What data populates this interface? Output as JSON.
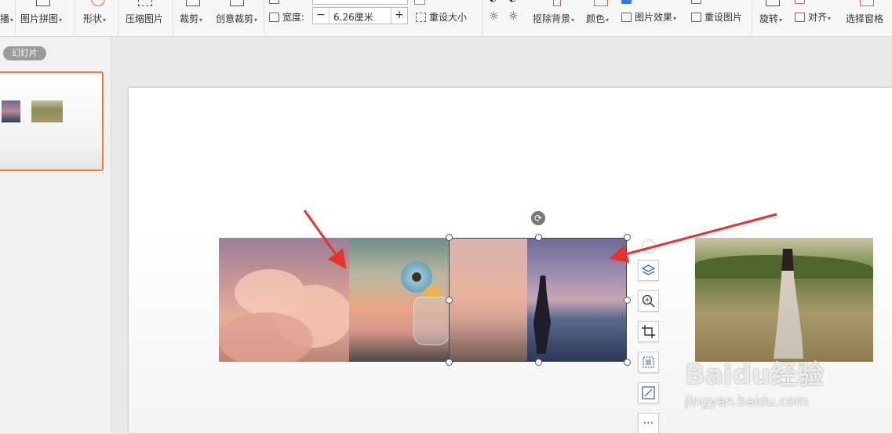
{
  "ribbon": {
    "picture_collage": "图片拼图",
    "shape": "形状",
    "compress": "压缩图片",
    "crop": "裁剪",
    "creative_crop": "创意裁剪",
    "width_label": "宽度:",
    "width_value": "6.26厘米",
    "reset_size": "重设大小",
    "remove_background": "抠除背景",
    "color": "颜色",
    "picture_effects": "图片效果",
    "reset_picture": "重设图片",
    "rotate": "旋转",
    "align": "对齐",
    "selection_pane": "选择窗格"
  },
  "slides_panel": {
    "tab_label": "幻灯片"
  },
  "watermark": {
    "brand": "Baidu经验",
    "url": "jingyan.baidu.com"
  },
  "colors": {
    "ribbon_bg": "#f7f7f7",
    "accent_orange": "#f27b3c",
    "arrow_red": "#e8322e"
  }
}
